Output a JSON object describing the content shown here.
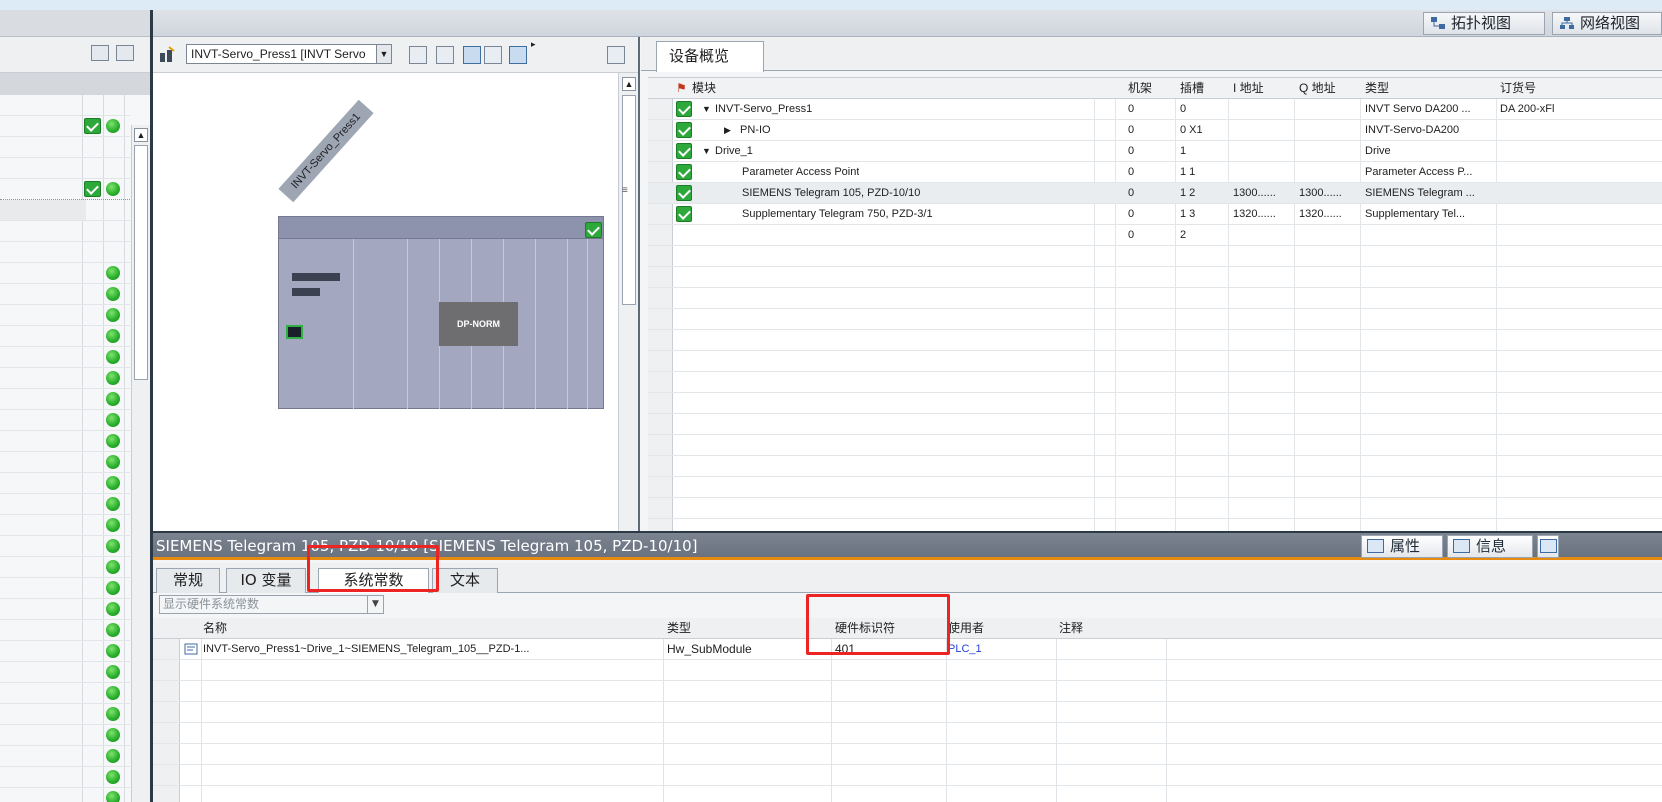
{
  "topbar": {
    "topology_view": "拓扑视图",
    "network_view": "网络视图"
  },
  "device_view": {
    "device_selector": "INVT-Servo_Press1 [INVT Servo",
    "device_label": "INVT-Servo_Press1",
    "module_label": "DP-NORM"
  },
  "overview": {
    "tab_label": "设备概览",
    "columns": {
      "module": "模块",
      "rack": "机架",
      "slot": "插槽",
      "i_address": "I 地址",
      "q_address": "Q 地址",
      "type": "类型",
      "order_no": "订货号"
    },
    "rows": [
      {
        "checked": true,
        "expander": "▼",
        "module": "INVT-Servo_Press1",
        "rack": "0",
        "slot": "0",
        "i_address": "",
        "q_address": "",
        "type": "INVT Servo DA200 ...",
        "order_no": "DA 200-xFl"
      },
      {
        "checked": true,
        "expander": "▶",
        "module": "PN-IO",
        "rack": "0",
        "slot": "0 X1",
        "i_address": "",
        "q_address": "",
        "type": "INVT-Servo-DA200",
        "order_no": ""
      },
      {
        "checked": true,
        "expander": "▼",
        "module": "Drive_1",
        "rack": "0",
        "slot": "1",
        "i_address": "",
        "q_address": "",
        "type": "Drive",
        "order_no": ""
      },
      {
        "checked": true,
        "expander": "",
        "module": "Parameter Access Point",
        "rack": "0",
        "slot": "1 1",
        "i_address": "",
        "q_address": "",
        "type": "Parameter Access P...",
        "order_no": ""
      },
      {
        "checked": true,
        "expander": "",
        "module": "SIEMENS Telegram 105, PZD-10/10",
        "rack": "0",
        "slot": "1 2",
        "i_address": "1300......",
        "q_address": "1300......",
        "type": "SIEMENS Telegram ...",
        "order_no": ""
      },
      {
        "checked": true,
        "expander": "",
        "module": "Supplementary Telegram 750, PZD-3/1",
        "rack": "0",
        "slot": "1 3",
        "i_address": "1320......",
        "q_address": "1320......",
        "type": "Supplementary Tel...",
        "order_no": ""
      },
      {
        "checked": false,
        "expander": "",
        "module": "",
        "rack": "0",
        "slot": "2",
        "i_address": "",
        "q_address": "",
        "type": "",
        "order_no": ""
      }
    ]
  },
  "properties": {
    "title": "SIEMENS Telegram 105, PZD-10/10 [SIEMENS Telegram 105, PZD-10/10]",
    "tabs": {
      "properties": "属性",
      "info": "信息"
    },
    "sub_tabs": [
      "常规",
      "IO 变量",
      "系统常数",
      "文本"
    ],
    "active_sub_tab": "系统常数",
    "filter": "显示硬件系统常数",
    "table": {
      "columns": {
        "name": "名称",
        "type": "类型",
        "hw_id": "硬件标识符",
        "used_by": "使用者",
        "comment": "注释"
      },
      "rows": [
        {
          "name": "INVT-Servo_Press1~Drive_1~SIEMENS_Telegram_105__PZD-1...",
          "type": "Hw_SubModule",
          "hw_id": "401",
          "used_by": "PLC_1",
          "comment": ""
        }
      ]
    }
  },
  "colors": {
    "accent_orange": "#e68a10",
    "highlight_red": "#ec2424",
    "status_green": "#2bb12e",
    "link_blue": "#1f3fd1"
  }
}
